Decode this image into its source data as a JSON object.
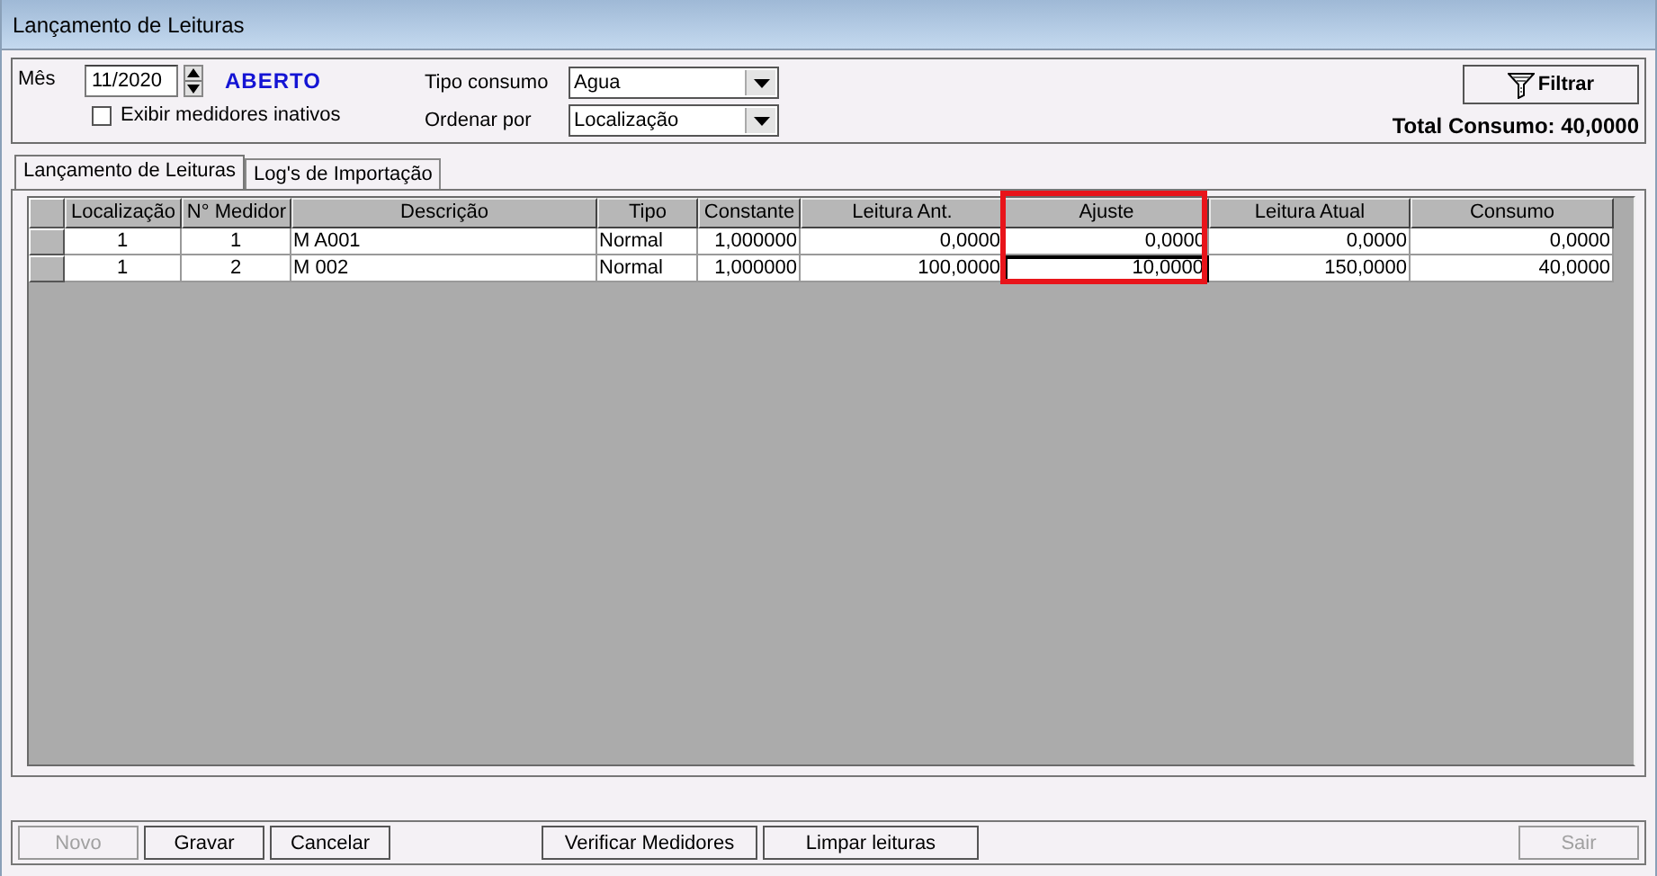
{
  "window": {
    "title": "Lançamento de Leituras"
  },
  "filters": {
    "month_label": "Mês",
    "month_value": "11/2020",
    "status": "ABERTO",
    "show_inactive": {
      "label": "Exibir medidores inativos",
      "checked": false
    },
    "consumption_type": {
      "label": "Tipo consumo",
      "value": "Agua"
    },
    "sort_by": {
      "label": "Ordenar por",
      "value": "Localização"
    },
    "filter_button": "Filtrar",
    "total": "Total Consumo: 40,0000"
  },
  "tabs": [
    {
      "label": "Lançamento de Leituras",
      "selected": true
    },
    {
      "label": "Log's de Importação",
      "selected": false
    }
  ],
  "table": {
    "columns": [
      {
        "label": "Localização",
        "highlighted": false
      },
      {
        "label": "N° Medidor",
        "highlighted": false
      },
      {
        "label": "Descrição",
        "highlighted": false
      },
      {
        "label": "Tipo",
        "highlighted": false
      },
      {
        "label": "Constante",
        "highlighted": false
      },
      {
        "label": "Leitura Ant.",
        "highlighted": false
      },
      {
        "label": "Ajuste",
        "highlighted": true
      },
      {
        "label": "Leitura Atual",
        "highlighted": false
      },
      {
        "label": "Consumo",
        "highlighted": false
      }
    ],
    "rows": [
      {
        "cells": [
          {
            "text": "1",
            "focused": false
          },
          {
            "text": "1",
            "focused": false
          },
          {
            "text": "M A001",
            "focused": false
          },
          {
            "text": "Normal",
            "focused": false
          },
          {
            "text": "1,000000",
            "focused": false
          },
          {
            "text": "0,0000",
            "focused": false
          },
          {
            "text": "0,0000",
            "focused": false
          },
          {
            "text": "0,0000",
            "focused": false
          },
          {
            "text": "0,0000",
            "focused": false
          }
        ]
      },
      {
        "cells": [
          {
            "text": "1",
            "focused": false
          },
          {
            "text": "2",
            "focused": false
          },
          {
            "text": "M 002",
            "focused": false
          },
          {
            "text": "Normal",
            "focused": false
          },
          {
            "text": "1,000000",
            "focused": false
          },
          {
            "text": "100,0000",
            "focused": false
          },
          {
            "text": "10,0000",
            "focused": true
          },
          {
            "text": "150,0000",
            "focused": false
          },
          {
            "text": "40,0000",
            "focused": false
          }
        ]
      }
    ]
  },
  "button_bar": {
    "left": [
      {
        "label": "Novo",
        "disabled": true
      },
      {
        "label": "Gravar",
        "disabled": false
      },
      {
        "label": "Cancelar",
        "disabled": false
      }
    ],
    "middle": [
      {
        "label": "Verificar Medidores",
        "disabled": false
      },
      {
        "label": "Limpar leituras",
        "disabled": false
      }
    ],
    "right": [
      {
        "label": "Sair",
        "disabled": true
      }
    ]
  }
}
